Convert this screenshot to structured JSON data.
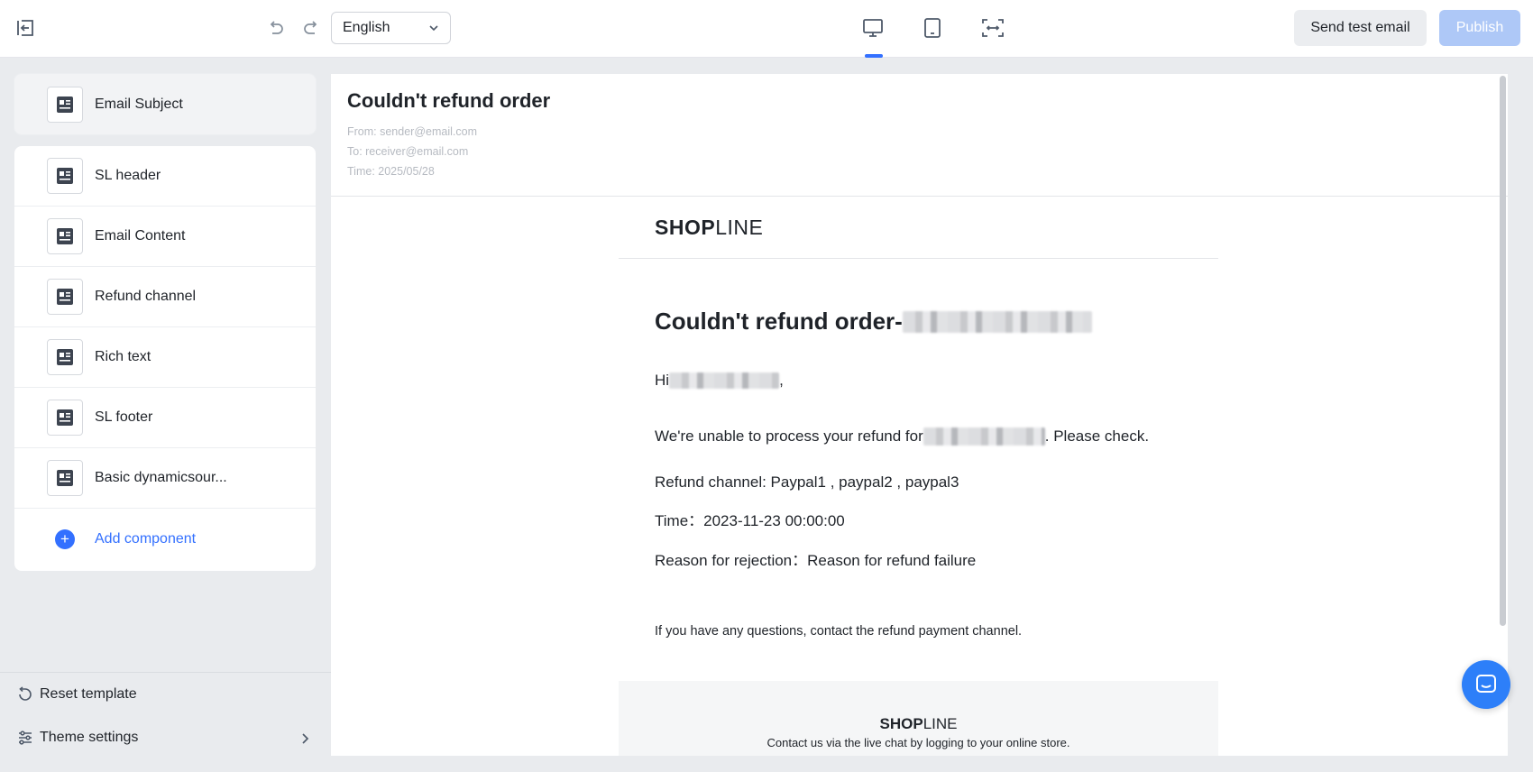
{
  "toolbar": {
    "language": "English",
    "send_test_label": "Send test email",
    "publish_label": "Publish"
  },
  "sidebar": {
    "subject_label": "Email Subject",
    "components": [
      {
        "label": "SL header"
      },
      {
        "label": "Email Content"
      },
      {
        "label": "Refund channel"
      },
      {
        "label": "Rich text"
      },
      {
        "label": "SL footer"
      },
      {
        "label": "Basic dynamicsour..."
      }
    ],
    "add_component_label": "Add component",
    "reset_label": "Reset template",
    "theme_label": "Theme settings"
  },
  "preview": {
    "subject": "Couldn't refund order",
    "from": "From: sender@email.com",
    "to": "To: receiver@email.com",
    "time": "Time: 2025/05/28",
    "logo_bold": "SH",
    "logo_o": "O",
    "logo_p": "P",
    "logo_light": "LINE",
    "title": "Couldn't refund order-",
    "greeting_prefix": "Hi",
    "greeting_suffix": " ,",
    "para_prefix": "We're unable to process your refund for",
    "para_suffix": ". Please check.",
    "refund_channel": "Refund channel: Paypal1 , paypal2 , paypal3",
    "time_line": "Time：2023-11-23 00:00:00",
    "reason_line": "Reason for rejection：Reason for refund failure",
    "note": "If you have any questions, contact the refund payment channel.",
    "footer_text": "Contact us via the live chat by logging to your online store."
  },
  "colors": {
    "accent": "#3370ff",
    "publish_disabled": "#aec8f7",
    "chat": "#2d7ff9"
  }
}
